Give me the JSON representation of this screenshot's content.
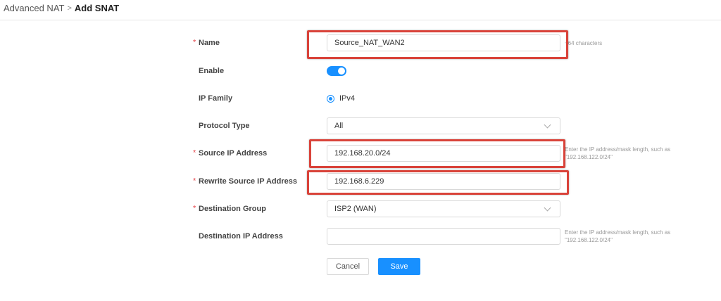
{
  "breadcrumb": {
    "parent": "Advanced NAT",
    "separator": ">",
    "current": "Add SNAT"
  },
  "form": {
    "name": {
      "label": "Name",
      "required": "*",
      "value": "Source_NAT_WAN2",
      "hint": "~64 characters"
    },
    "enable": {
      "label": "Enable",
      "on": true
    },
    "ip_family": {
      "label": "IP Family",
      "option": "IPv4",
      "selected": true
    },
    "protocol_type": {
      "label": "Protocol Type",
      "value": "All"
    },
    "source_ip": {
      "label": "Source IP Address",
      "required": "*",
      "value": "192.168.20.0/24",
      "hint_line1": "Enter the IP address/mask length, such as",
      "hint_line2": "\"192.168.122.0/24\""
    },
    "rewrite_source_ip": {
      "label": "Rewrite Source IP Address",
      "required": "*",
      "value": "192.168.6.229"
    },
    "destination_group": {
      "label": "Destination Group",
      "required": "*",
      "value": "ISP2 (WAN)"
    },
    "destination_ip": {
      "label": "Destination IP Address",
      "value": "",
      "hint_line1": "Enter the IP address/mask length, such as",
      "hint_line2": "\"192.168.122.0/24\""
    }
  },
  "actions": {
    "cancel": "Cancel",
    "save": "Save"
  },
  "colors": {
    "accent": "#1890ff",
    "highlight": "#d9433a",
    "required": "#e5484d"
  }
}
